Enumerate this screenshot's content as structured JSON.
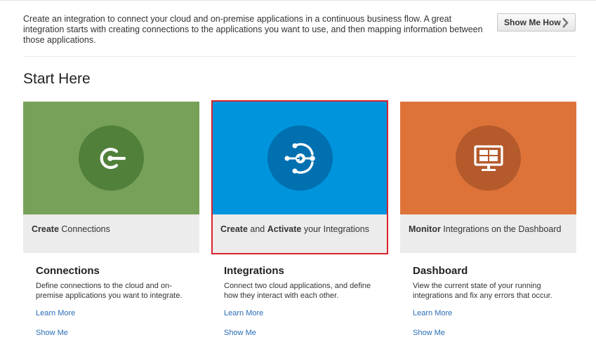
{
  "intro": {
    "text": "Create an integration to connect your cloud and on-premise applications in a continuous business flow. A great integration starts with creating connections to the applications you want to use, and then mapping information between those applications.",
    "show_me_how_label": "Show Me How"
  },
  "start_here": {
    "title": "Start Here"
  },
  "cards": [
    {
      "icon": "connection-plug-icon",
      "color": "#77a158",
      "caption_bold": "Create",
      "caption_rest": " Connections"
    },
    {
      "icon": "integration-hub-icon",
      "color": "#0094dc",
      "caption_bold": "Create",
      "caption_mid": " and ",
      "caption_bold2": "Activate",
      "caption_rest": " your Integrations",
      "selected": true
    },
    {
      "icon": "monitor-dashboard-icon",
      "color": "#de733a",
      "caption_bold": "Monitor",
      "caption_rest": " Integrations on the Dashboard"
    }
  ],
  "sections": [
    {
      "title": "Connections",
      "description": "Define connections to the cloud and on-premise applications you want to integrate.",
      "learn_more": "Learn More",
      "show_me": "Show Me"
    },
    {
      "title": "Integrations",
      "description": "Connect two cloud applications, and define how they interact with each other.",
      "learn_more": "Learn More",
      "show_me": "Show Me"
    },
    {
      "title": "Dashboard",
      "description": "View the current state of your running integrations and fix any errors that occur.",
      "learn_more": "Learn More",
      "show_me": "Show Me"
    }
  ],
  "colors": {
    "highlight_border": "#d8232a",
    "link": "#2a6db5"
  }
}
